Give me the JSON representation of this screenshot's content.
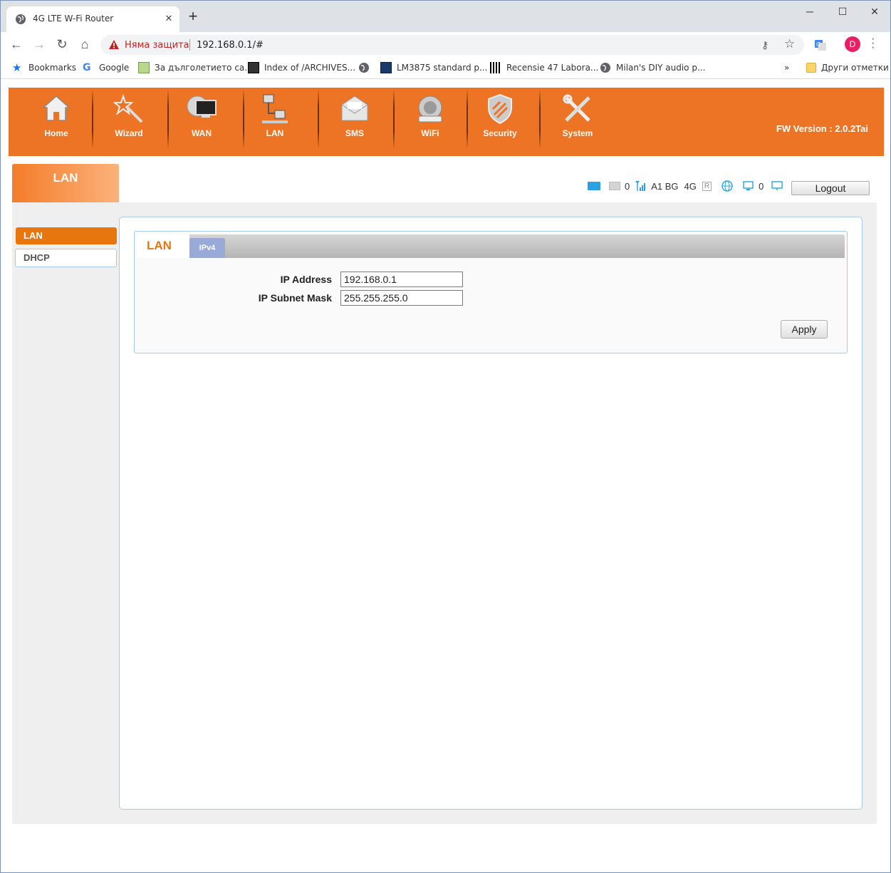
{
  "browser": {
    "tab_title": "4G LTE W-Fi Router",
    "security_text": "Няма защита",
    "url": "192.168.0.1/#",
    "avatar_letter": "D",
    "window_controls": [
      "minimize",
      "maximize",
      "close"
    ]
  },
  "bookmarks": [
    {
      "label": "Bookmarks",
      "icon": "star-icon"
    },
    {
      "label": "Google",
      "icon": "google-icon"
    },
    {
      "label": "За дълголетието са...",
      "icon": "site-icon"
    },
    {
      "label": "Index of /ARCHIVES...",
      "icon": "site-icon"
    },
    {
      "label": "",
      "icon": "globe-icon"
    },
    {
      "label": "LM3875 standard p...",
      "icon": "site-icon"
    },
    {
      "label": "Recensie 47 Labora...",
      "icon": "site-icon"
    },
    {
      "label": "Milan's DIY audio p...",
      "icon": "globe-icon"
    },
    {
      "label": "Други отметки",
      "icon": "folder-icon"
    }
  ],
  "router": {
    "nav": [
      {
        "label": "Home",
        "icon": "home-icon"
      },
      {
        "label": "Wizard",
        "icon": "wizard-icon"
      },
      {
        "label": "WAN",
        "icon": "wan-icon"
      },
      {
        "label": "LAN",
        "icon": "lan-icon"
      },
      {
        "label": "SMS",
        "icon": "sms-icon"
      },
      {
        "label": "WiFi",
        "icon": "wifi-icon"
      },
      {
        "label": "Security",
        "icon": "security-icon"
      },
      {
        "label": "System",
        "icon": "system-icon"
      }
    ],
    "fw_version": "FW Version : 2.0.2Tai",
    "page_tab": "LAN",
    "status": {
      "sms_count": "0",
      "operator": "A1 BG",
      "network": "4G",
      "roaming": "R",
      "clients_count": "0"
    },
    "logout_label": "Logout",
    "sidebar": [
      {
        "label": "LAN",
        "active": true
      },
      {
        "label": "DHCP",
        "active": false
      }
    ],
    "card": {
      "title": "LAN",
      "subtab": "IPv4",
      "fields": [
        {
          "label": "IP Address",
          "value": "192.168.0.1"
        },
        {
          "label": "IP Subnet Mask",
          "value": "255.255.255.0"
        }
      ],
      "apply_label": "Apply"
    }
  },
  "colors": {
    "accent": "#ed7424",
    "border": "#a8cbe3",
    "subtab": "#9aaad8"
  }
}
